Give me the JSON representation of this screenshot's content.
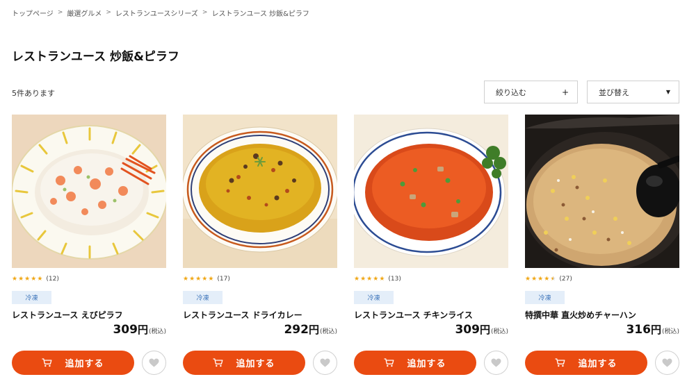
{
  "breadcrumb": [
    {
      "label": "トップページ"
    },
    {
      "label": "厳選グルメ"
    },
    {
      "label": "レストランユースシリーズ"
    },
    {
      "label": "レストランユース 炒飯&ピラフ"
    }
  ],
  "breadcrumb_separator": ">",
  "page": {
    "title": "レストランユース 炒飯&ピラフ",
    "result_count": "5件あります"
  },
  "controls": {
    "filter_label": "絞り込む",
    "filter_indicator": "+",
    "sort_label": "並び替え",
    "sort_indicator": "▼"
  },
  "products": [
    {
      "name": "レストランユース えびピラフ",
      "rating": 5,
      "review_count": "(12)",
      "tag": "冷凍",
      "price": "309",
      "currency": "円",
      "tax": "(税込)",
      "cart_label": "追加する"
    },
    {
      "name": "レストランユース ドライカレー",
      "rating": 5,
      "review_count": "(17)",
      "tag": "冷凍",
      "price": "292",
      "currency": "円",
      "tax": "(税込)",
      "cart_label": "追加する"
    },
    {
      "name": "レストランユース チキンライス",
      "rating": 5,
      "review_count": "(13)",
      "tag": "冷凍",
      "price": "309",
      "currency": "円",
      "tax": "(税込)",
      "cart_label": "追加する"
    },
    {
      "name": "特撰中華 直火炒めチャーハン",
      "rating": 4.5,
      "review_count": "(27)",
      "tag": "冷凍",
      "price": "316",
      "currency": "円",
      "tax": "(税込)",
      "cart_label": "追加する"
    }
  ],
  "icons": {
    "cart": "cart-icon",
    "favorite": "heart-icon",
    "star": "star-icon"
  },
  "colors": {
    "accent": "#ea4b11",
    "star": "#f0a716",
    "tag_bg": "#e4eef9",
    "tag_text": "#3b73b9"
  }
}
